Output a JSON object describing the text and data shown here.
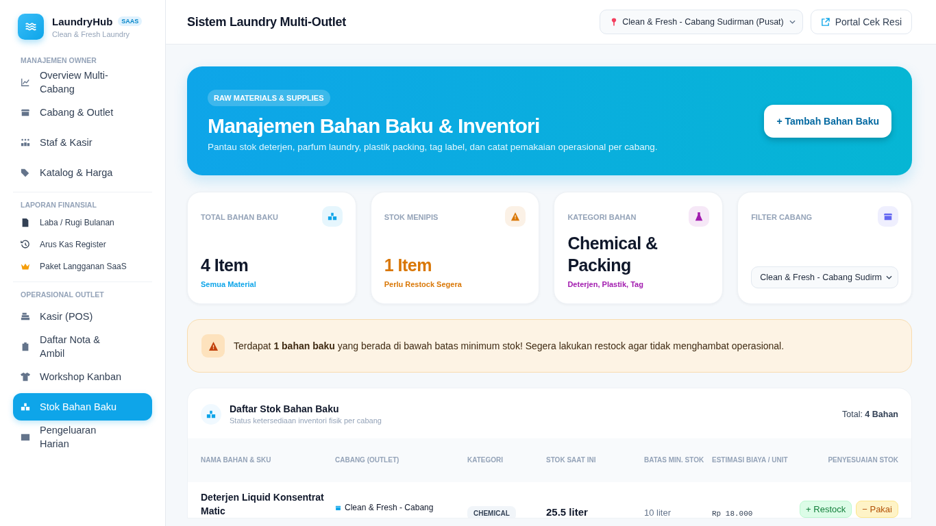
{
  "brand": {
    "name": "LaundryHub",
    "badge": "SAAS",
    "tagline": "Clean & Fresh Laundry"
  },
  "sidebar": {
    "sections": [
      {
        "title": "MANAJEMEN OWNER",
        "items": [
          {
            "label": "Overview Multi-Cabang",
            "selected": false
          },
          {
            "label": "Cabang & Outlet",
            "selected": false
          },
          {
            "label": "Staf & Kasir",
            "selected": false
          },
          {
            "label": "Katalog & Harga",
            "selected": false
          }
        ]
      },
      {
        "title": "LAPORAN FINANSIAL",
        "items": [
          {
            "label": "Laba / Rugi Bulanan",
            "selected": false
          },
          {
            "label": "Arus Kas Register",
            "selected": false
          },
          {
            "label": "Paket Langganan SaaS",
            "selected": false
          }
        ]
      },
      {
        "title": "OPERASIONAL OUTLET",
        "items": [
          {
            "label": "Kasir (POS)",
            "selected": false
          },
          {
            "label": "Daftar Nota & Ambil",
            "selected": false
          },
          {
            "label": "Workshop Kanban",
            "selected": false
          },
          {
            "label": "Stok Bahan Baku",
            "selected": true
          },
          {
            "label": "Pengeluaran Harian",
            "selected": false
          }
        ]
      }
    ]
  },
  "header": {
    "title": "Sistem Laundry Multi-Outlet",
    "outlet_select": "Clean & Fresh - Cabang Sudirman (Pusat)",
    "portal_button": "Portal Cek Resi"
  },
  "hero": {
    "eyebrow": "RAW MATERIALS & SUPPLIES",
    "title": "Manajemen Bahan Baku & Inventori",
    "subtitle": "Pantau stok deterjen, parfum laundry, plastik packing, tag label, dan catat pemakaian operasional per cabang.",
    "button": "+ Tambah Bahan Baku"
  },
  "stats": [
    {
      "kind": "value",
      "label": "TOTAL BAHAN BAKU",
      "value": "4 Item",
      "note": "Semua Material",
      "color": "#0ea5e9"
    },
    {
      "kind": "value",
      "label": "STOK MENIPIS",
      "value": "1 Item",
      "note": "Perlu Restock Segera",
      "color": "#d97706"
    },
    {
      "kind": "value",
      "label": "KATEGORI BAHAN",
      "value": "Chemical & Packing",
      "note": "Deterjen, Plastik, Tag",
      "color": "#a21caf"
    },
    {
      "kind": "select",
      "label": "FILTER CABANG",
      "value": "Clean & Fresh - Cabang Sudirm",
      "color": "#6366f1"
    }
  ],
  "alert": {
    "text": "Terdapat **1 bahan baku** yang berada di bawah batas minimum stok! Segera lakukan restock agar tidak menghambat operasional."
  },
  "table": {
    "title": "Daftar Stok Bahan Baku",
    "subtitle": "Status ketersediaan inventori fisik per cabang",
    "total": "Total: **4 Bahan**",
    "columns": [
      "NAMA BAHAN & SKU",
      "CABANG (OUTLET)",
      "KATEGORI",
      "STOK SAAT INI",
      "BATAS MIN. STOK",
      "ESTIMASI BIAYA / UNIT",
      "PENYESUAIAN STOK"
    ],
    "rows": [
      {
        "name": "Deterjen Liquid Konsentrat Matic",
        "outlet": "Clean & Fresh - Cabang",
        "category": "CHEMICAL",
        "stock": "25.5 liter",
        "min": "10 liter",
        "cost": "Rp 18.000",
        "restock": "+ Restock",
        "use": "− Pakai"
      }
    ]
  }
}
